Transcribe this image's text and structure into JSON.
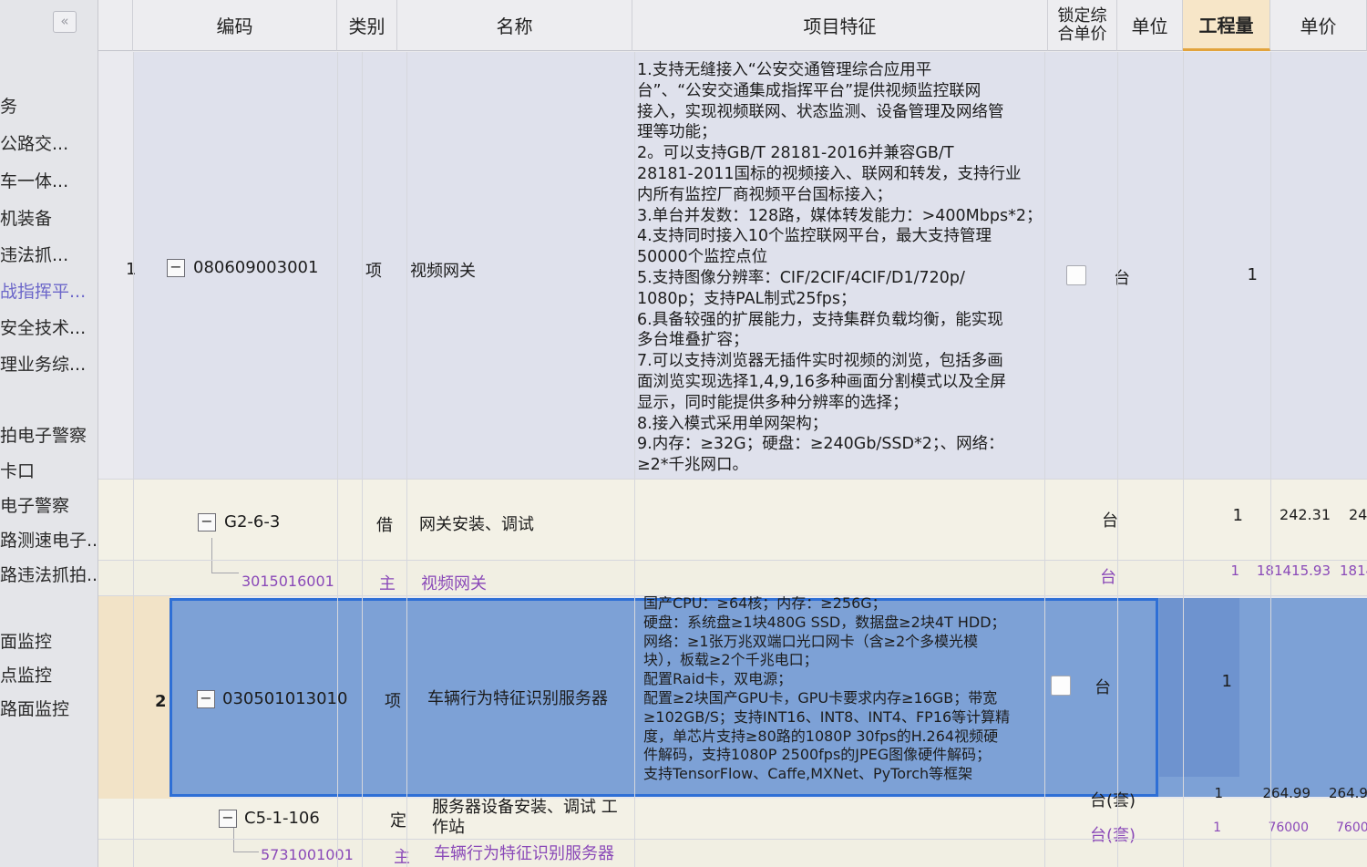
{
  "sidebar": {
    "collapse_label": "«",
    "items": [
      {
        "label": "务"
      },
      {
        "label": "公路交..."
      },
      {
        "label": "车一体..."
      },
      {
        "label": "机装备"
      },
      {
        "label": "违法抓..."
      },
      {
        "label": "战指挥平..."
      },
      {
        "label": "安全技术..."
      },
      {
        "label": "理业务综..."
      },
      {
        "label": "拍电子警察"
      },
      {
        "label": "卡口"
      },
      {
        "label": "电子警察"
      },
      {
        "label": "路测速电子..."
      },
      {
        "label": "路违法抓拍..."
      },
      {
        "label": "面监控"
      },
      {
        "label": "点监控"
      },
      {
        "label": "路面监控"
      }
    ]
  },
  "header": {
    "code": "编码",
    "category": "类别",
    "name": "名称",
    "feature": "项目特征",
    "lock_line1": "锁定综",
    "lock_line2": "合单价",
    "unit": "单位",
    "quantity": "工程量",
    "price": "单价"
  },
  "rows": {
    "r1": {
      "index": "1",
      "toggle": "−",
      "code": "080609003001",
      "category": "项",
      "name": "视频网关",
      "unit": "台",
      "quantity": "1",
      "feature": "1.支持无缝接入“公安交通管理综合应用平\n台”、“公安交通集成指挥平台”提供视频监控联网\n接入，实现视频联网、状态监测、设备管理及网络管\n理等功能；\n2。可以支持GB/T 28181-2016并兼容GB/T\n28181-2011国标的视频接入、联网和转发，支持行业\n内所有监控厂商视频平台国标接入；\n3.单台并发数：128路，媒体转发能力：>400Mbps*2；\n4.支持同时接入10个监控联网平台，最大支持管理\n50000个监控点位\n5.支持图像分辨率：CIF/2CIF/4CIF/D1/720p/\n1080p；支持PAL制式25fps；\n6.具备较强的扩展能力，支持集群负载均衡，能实现\n多台堆叠扩容；\n7.可以支持浏览器无插件实时视频的浏览，包括多画\n面浏览实现选择1,4,9,16多种画面分割模式以及全屏\n显示，同时能提供多种分辨率的选择；\n8.接入模式采用单网架构；\n9.内存：≥32G；硬盘：≥240Gb/SSD*2；、网络：\n≥2*千兆网口。"
    },
    "r1a": {
      "toggle": "−",
      "code": "G2-6-3",
      "category": "借",
      "name": "网关安装、调试",
      "unit": "台",
      "quantity": "1",
      "price": "242.31",
      "price2": "24"
    },
    "r1b": {
      "code": "3015016001",
      "category": "主",
      "name": "视频网关",
      "unit": "台",
      "quantity": "1",
      "price": "181415.93",
      "price2": "1814"
    },
    "r2": {
      "index": "2",
      "toggle": "−",
      "code": "030501013010",
      "category": "项",
      "name": "车辆行为特征识别服务器",
      "unit": "台",
      "quantity": "1",
      "feature": "国产CPU：≥64核；内存：≥256G；\n硬盘：系统盘≥1块480G SSD，数据盘≥2块4T HDD；\n网络：≥1张万兆双端口光口网卡（含≥2个多模光模\n块），板载≥2个千兆电口；\n配置Raid卡，双电源；\n配置≥2块国产GPU卡，GPU卡要求内存≥16GB；带宽\n≥102GB/S；支持INT16、INT8、INT4、FP16等计算精\n度，单芯片支持≥80路的1080P 30fps的H.264视频硬\n件解码，支持1080P 2500fps的JPEG图像硬件解码；\n支持TensorFlow、Caffe,MXNet、PyTorch等框架"
    },
    "r2a": {
      "toggle": "−",
      "code": "C5-1-106",
      "category": "定",
      "name_line1": "服务器设备安装、调试 工",
      "name_line2": "作站",
      "unit": "台(套)",
      "quantity": "1",
      "price": "264.99",
      "price2": "264.9"
    },
    "r2b": {
      "code": "5731001001",
      "category": "主",
      "name": "车辆行为特征识别服务器",
      "unit": "台(套)",
      "quantity": "1",
      "price": "76000",
      "price2": "7600"
    },
    "r3_partial": "...4核；内存：≥256G..."
  }
}
